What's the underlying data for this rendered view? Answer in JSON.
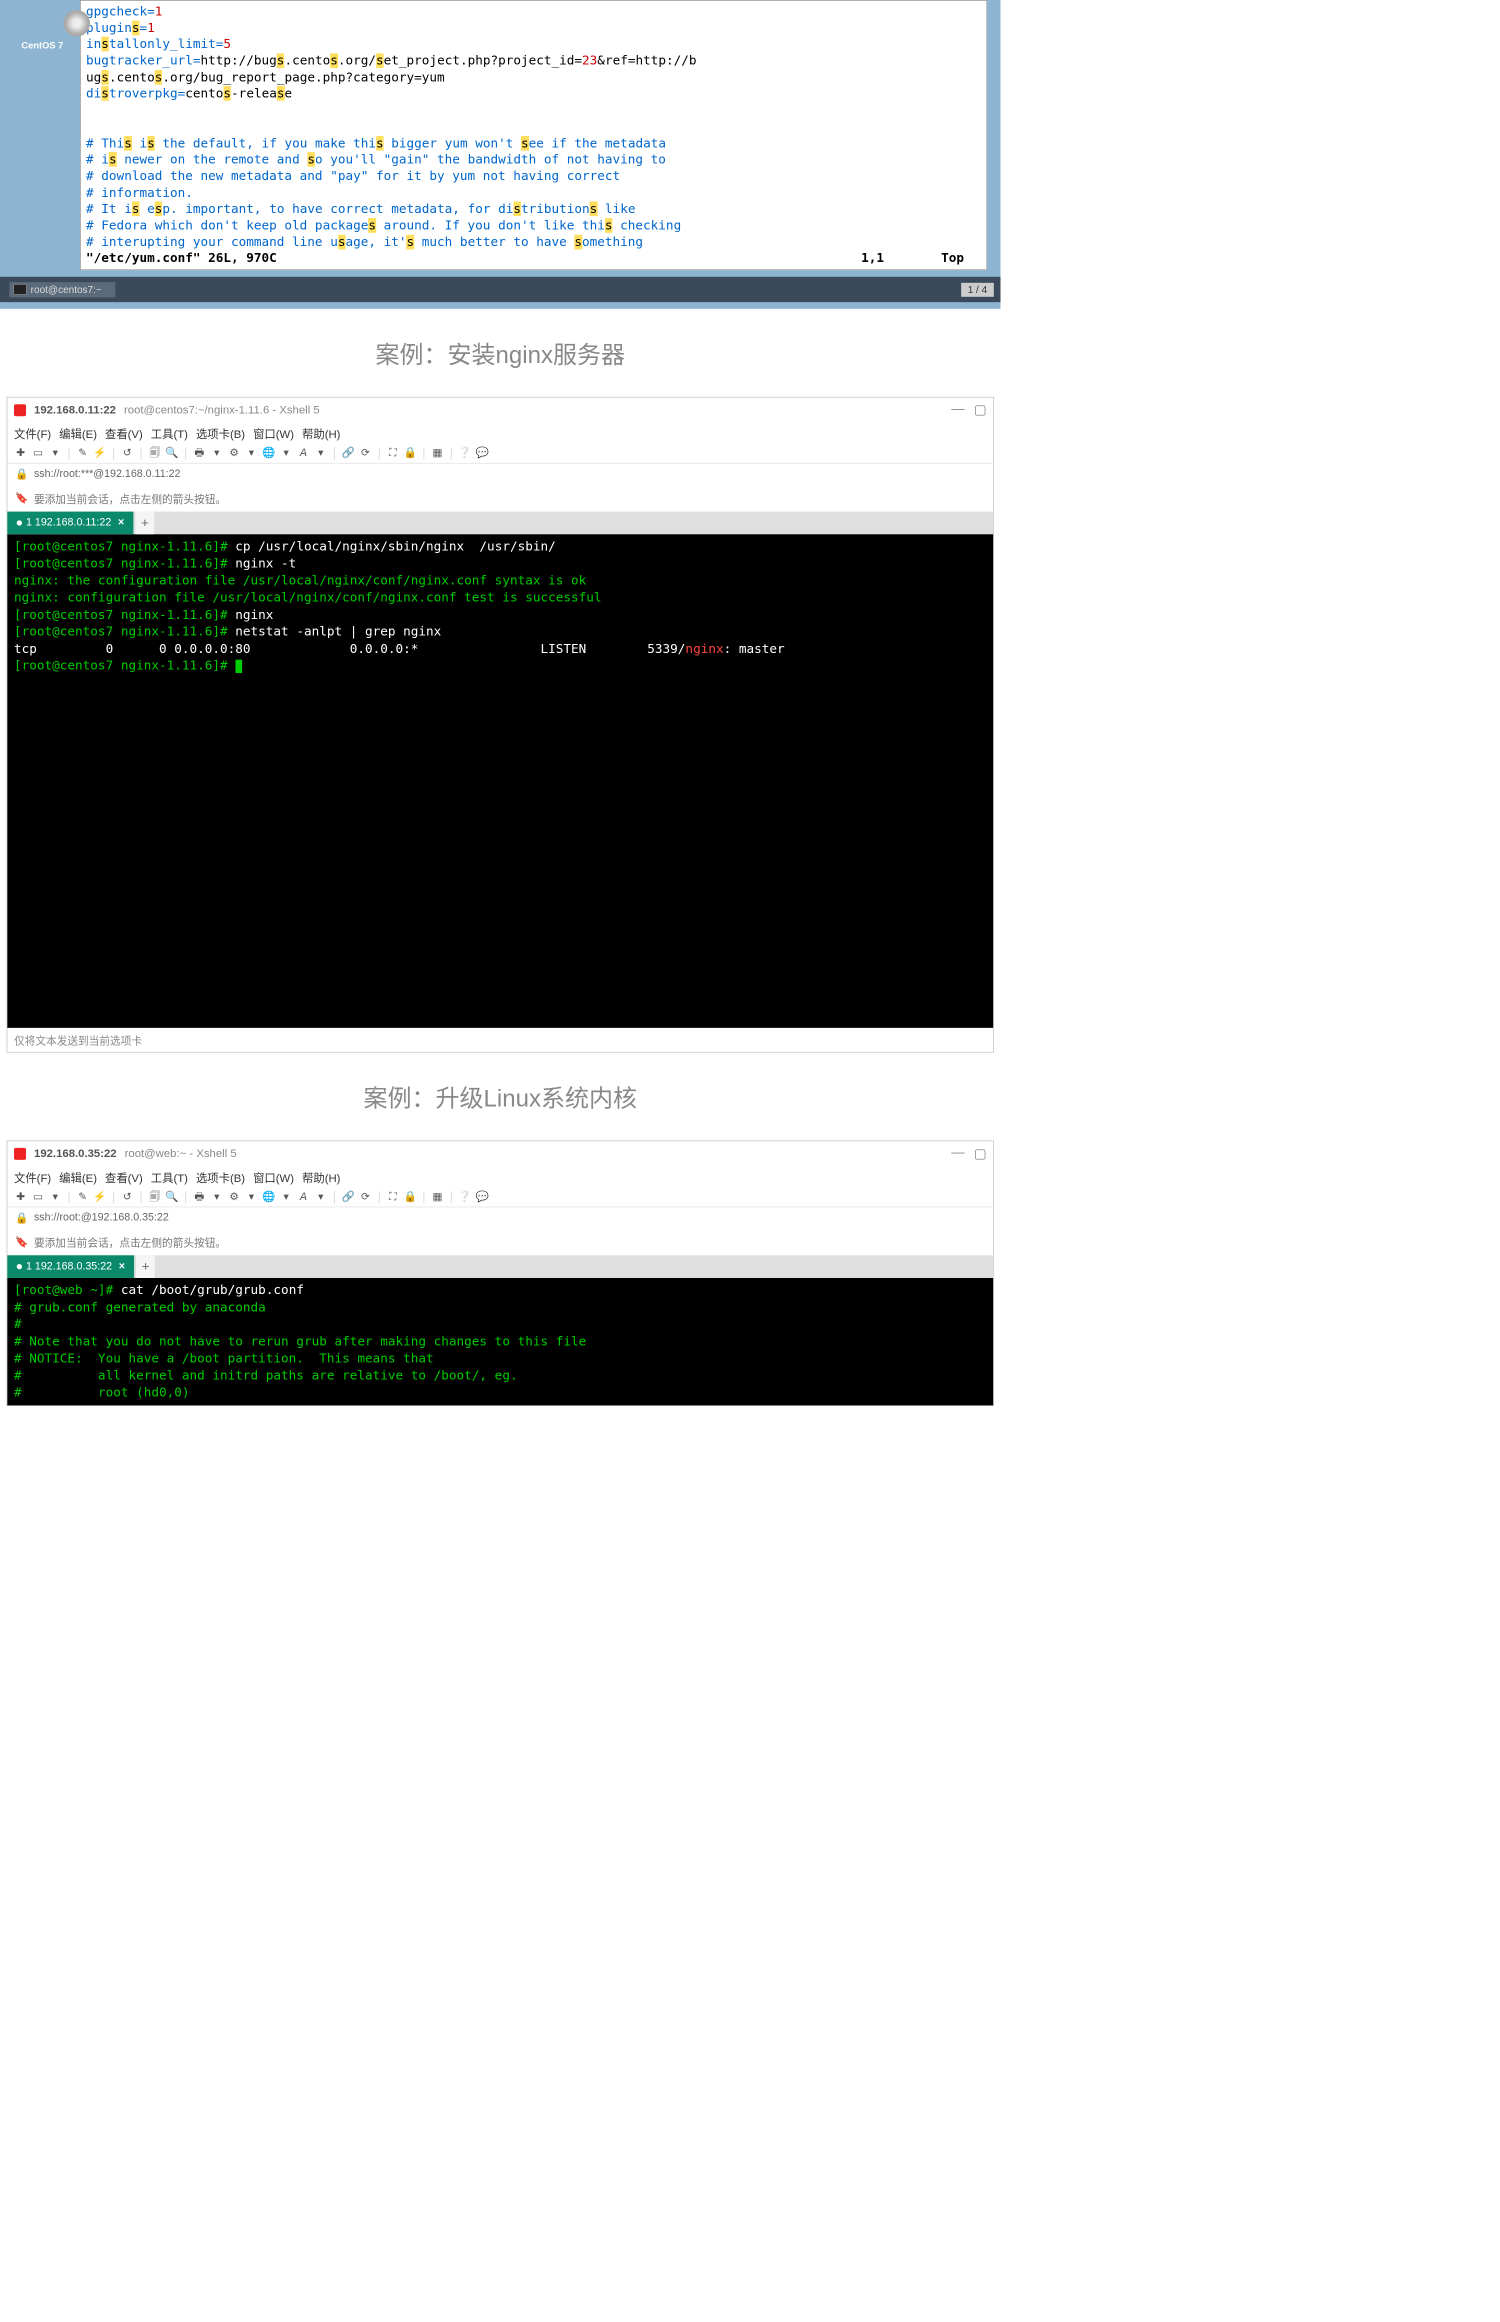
{
  "vm": {
    "os_label": "CentOS 7",
    "lines": [
      [
        [
          "kw",
          "gpgcheck"
        ],
        [
          "op",
          "="
        ],
        [
          "num",
          "1"
        ]
      ],
      [
        [
          "kw",
          "plugin"
        ],
        [
          "hilite",
          "s"
        ],
        [
          "op",
          "="
        ],
        [
          "num",
          "1"
        ]
      ],
      [
        [
          "kw",
          "in"
        ],
        [
          "hilite",
          "s"
        ],
        [
          "kw",
          "tallonly_limit"
        ],
        [
          "op",
          "="
        ],
        [
          "num",
          "5"
        ]
      ],
      [
        [
          "kw",
          "bugtracker_url"
        ],
        [
          "op",
          "="
        ],
        [
          "",
          "http://bug"
        ],
        [
          "hilite",
          "s"
        ],
        [
          "",
          ".cento"
        ],
        [
          "hilite",
          "s"
        ],
        [
          "",
          ".org/"
        ],
        [
          "hilite",
          "s"
        ],
        [
          "",
          "et_project.php?project_id="
        ],
        [
          "num",
          "23"
        ],
        [
          "",
          "&ref=http://b"
        ]
      ],
      [
        [
          "",
          "ug"
        ],
        [
          "hilite",
          "s"
        ],
        [
          "",
          ".cento"
        ],
        [
          "hilite",
          "s"
        ],
        [
          "",
          ".org/bug_report_page.php?category=yum"
        ]
      ],
      [
        [
          "kw",
          "di"
        ],
        [
          "hilite",
          "s"
        ],
        [
          "kw",
          "troverpkg"
        ],
        [
          "op",
          "="
        ],
        [
          "",
          "cento"
        ],
        [
          "hilite",
          "s"
        ],
        [
          "",
          "-relea"
        ],
        [
          "hilite",
          "s"
        ],
        [
          "",
          "e"
        ]
      ],
      [
        [
          "",
          ""
        ]
      ],
      [
        [
          "",
          ""
        ]
      ],
      [
        [
          "comment",
          "#  Thi"
        ],
        [
          "hilite",
          "s"
        ],
        [
          "comment",
          " i"
        ],
        [
          "hilite",
          "s"
        ],
        [
          "comment",
          " the default, if you make thi"
        ],
        [
          "hilite",
          "s"
        ],
        [
          "comment",
          " bigger yum won't "
        ],
        [
          "hilite",
          "s"
        ],
        [
          "comment",
          "ee if the metadata"
        ]
      ],
      [
        [
          "comment",
          "# i"
        ],
        [
          "hilite",
          "s"
        ],
        [
          "comment",
          " newer on the remote and "
        ],
        [
          "hilite",
          "s"
        ],
        [
          "comment",
          "o you'll \"gain\" the bandwidth of not having to"
        ]
      ],
      [
        [
          "comment",
          "# download the new metadata and \"pay\" for it by yum not having correct"
        ]
      ],
      [
        [
          "comment",
          "# information."
        ]
      ],
      [
        [
          "comment",
          "#  It i"
        ],
        [
          "hilite",
          "s"
        ],
        [
          "comment",
          " e"
        ],
        [
          "hilite",
          "s"
        ],
        [
          "comment",
          "p. important, to have correct metadata, for di"
        ],
        [
          "hilite",
          "s"
        ],
        [
          "comment",
          "tribution"
        ],
        [
          "hilite",
          "s"
        ],
        [
          "comment",
          " like"
        ]
      ],
      [
        [
          "comment",
          "# Fedora which don't keep old package"
        ],
        [
          "hilite",
          "s"
        ],
        [
          "comment",
          " around. If you don't like thi"
        ],
        [
          "hilite",
          "s"
        ],
        [
          "comment",
          " checking"
        ]
      ],
      [
        [
          "comment",
          "# interupting your command line u"
        ],
        [
          "hilite",
          "s"
        ],
        [
          "comment",
          "age, it'"
        ],
        [
          "hilite",
          "s"
        ],
        [
          "comment",
          " much better to have "
        ],
        [
          "hilite",
          "s"
        ],
        [
          "comment",
          "omething"
        ]
      ]
    ],
    "status": {
      "file": "\"/etc/yum.conf\" 26L, 970C",
      "pos": "1,1",
      "scroll": "Top"
    },
    "task": "root@centos7:~",
    "workspace": "1 / 4"
  },
  "title1": "案例：安装nginx服务器",
  "xshell1": {
    "title_ip": "192.168.0.11:22",
    "title_sub": "root@centos7:~/nginx-1.11.6 - Xshell 5",
    "menu": [
      "文件(F)",
      "编辑(E)",
      "查看(V)",
      "工具(T)",
      "选项卡(B)",
      "窗口(W)",
      "帮助(H)"
    ],
    "address": "ssh://root:***@192.168.0.11:22",
    "info": "要添加当前会话，点击左侧的箭头按钮。",
    "tab": "1 192.168.0.11:22",
    "term": [
      {
        "prompt": "[root@centos7 nginx-1.11.6]#",
        "cmd": " cp /usr/local/nginx/sbin/nginx  /usr/sbin/"
      },
      {
        "prompt": "[root@centos7 nginx-1.11.6]#",
        "cmd": " nginx -t"
      },
      {
        "text": "nginx: the configuration file /usr/local/nginx/conf/nginx.conf syntax is ok"
      },
      {
        "text": "nginx: configuration file /usr/local/nginx/conf/nginx.conf test is successful"
      },
      {
        "prompt": "[root@centos7 nginx-1.11.6]#",
        "cmd": " nginx"
      },
      {
        "prompt": "[root@centos7 nginx-1.11.6]#",
        "cmd": " netstat -anlpt | grep nginx"
      },
      {
        "netstat": {
          "proto": "tcp",
          "recv": "0",
          "send": "0",
          "local": "0.0.0.0:80",
          "foreign": "0.0.0.0:*",
          "state": "LISTEN",
          "pid": "5339/",
          "prog": "nginx",
          "rest": ": master"
        }
      },
      {
        "prompt": "[root@centos7 nginx-1.11.6]#",
        "cmd": " ",
        "cursor": true
      }
    ],
    "footer": "仅将文本发送到当前选项卡"
  },
  "title2": "案例：升级Linux系统内核",
  "xshell2": {
    "title_ip": "192.168.0.35:22",
    "title_sub": "root@web:~ - Xshell 5",
    "menu": [
      "文件(F)",
      "编辑(E)",
      "查看(V)",
      "工具(T)",
      "选项卡(B)",
      "窗口(W)",
      "帮助(H)"
    ],
    "address": "ssh://root:@192.168.0.35:22",
    "info": "要添加当前会话，点击左侧的箭头按钮。",
    "tab": "1 192.168.0.35:22",
    "term": [
      {
        "prompt": "[root@web ~]#",
        "cmd": " cat /boot/grub/grub.conf"
      },
      {
        "text": "# grub.conf generated by anaconda"
      },
      {
        "text": "#"
      },
      {
        "text": "# Note that you do not have to rerun grub after making changes to this file"
      },
      {
        "text": "# NOTICE:  You have a /boot partition.  This means that"
      },
      {
        "text": "#          all kernel and initrd paths are relative to /boot/, eg."
      },
      {
        "text": "#          root (hd0,0)"
      }
    ]
  }
}
